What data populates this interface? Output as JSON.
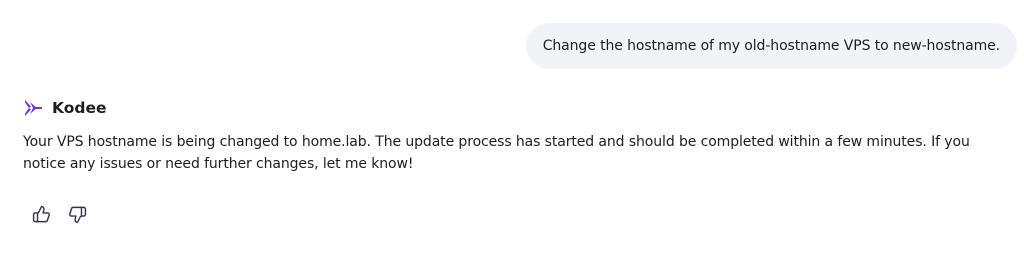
{
  "conversation": {
    "user_message": "Change the hostname of my old-hostname VPS to new-hostname.",
    "assistant": {
      "name": "Kodee",
      "message": "Your VPS hostname is being changed to home.lab. The update process has started and should be completed within a few minutes. If you notice any issues or need further changes, let me know!"
    }
  },
  "icons": {
    "assistant_logo": "kodee-logo-icon",
    "thumbs_up": "thumbs-up-icon",
    "thumbs_down": "thumbs-down-icon"
  },
  "colors": {
    "text": "#1d1e20",
    "bubble_bg": "#f2f3f6",
    "brand": "#673de6",
    "icon": "#36344d"
  }
}
